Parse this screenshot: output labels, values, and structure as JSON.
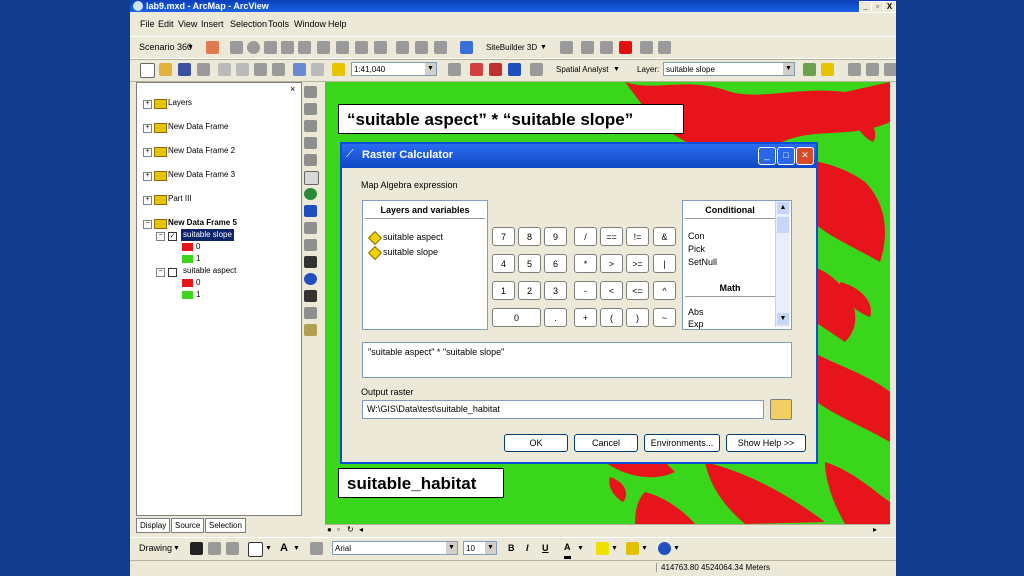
{
  "window": {
    "title": "lab9.mxd - ArcMap - ArcView",
    "controls": [
      "_",
      "▫",
      "X"
    ]
  },
  "menubar": {
    "items": [
      "File",
      "Edit",
      "View",
      "Insert",
      "Selection",
      "Tools",
      "Window",
      "Help"
    ]
  },
  "toolbar1": {
    "scenario": "Scenario 360",
    "sitebuilder": "SiteBuilder 3D"
  },
  "toolbar2": {
    "scale": "1:41,040",
    "spatial_analyst": "Spatial Analyst",
    "layer_label": "Layer:",
    "layer_value": "suitable slope"
  },
  "toc": {
    "frames": [
      "Layers",
      "New Data Frame",
      "New Data Frame 2",
      "New Data Frame 3",
      "Part III"
    ],
    "active_frame": "New Data Frame 5",
    "layers": [
      {
        "name": "suitable slope",
        "checked": true,
        "classes": [
          "0",
          "1"
        ]
      },
      {
        "name": "suitable aspect",
        "checked": false,
        "classes": [
          "0",
          "1"
        ]
      }
    ],
    "tabs": [
      "Display",
      "Source",
      "Selection"
    ]
  },
  "captions": {
    "top": "“suitable aspect” * “suitable slope”",
    "bottom": "suitable_habitat"
  },
  "dialog": {
    "title": "Raster Calculator",
    "expr_section": "Map Algebra expression",
    "layers_header": "Layers and variables",
    "layers": [
      "suitable aspect",
      "suitable slope"
    ],
    "keypad": [
      [
        "7",
        "8",
        "9",
        "/",
        "==",
        "!=",
        "&"
      ],
      [
        "4",
        "5",
        "6",
        "*",
        ">",
        ">=",
        "|"
      ],
      [
        "1",
        "2",
        "3",
        "-",
        "<",
        "<=",
        "^"
      ],
      [
        "0",
        ".",
        "+",
        "(",
        ")",
        "~"
      ]
    ],
    "conditional_header": "Conditional",
    "conditional_items": [
      "Con",
      "Pick",
      "SetNull"
    ],
    "math_header": "Math",
    "math_items": [
      "Abs",
      "Exp"
    ],
    "expression": "\"suitable aspect\" * \"suitable slope\"",
    "output_label": "Output raster",
    "output_path": "W:\\GIS\\Data\\test\\suitable_habitat",
    "buttons": {
      "ok": "OK",
      "cancel": "Cancel",
      "env": "Environments...",
      "help": "Show Help >>"
    }
  },
  "draw_toolbar": {
    "drawing": "Drawing",
    "font": "Arial",
    "size": "10",
    "bold": "B",
    "italic": "I",
    "underline": "U",
    "text_tool": "A"
  },
  "status": {
    "coords": "414763.80  4524064.34 Meters"
  },
  "colors": {
    "map_green": "#39d61c",
    "map_red": "#e8141c",
    "title_blue": "#0a3fb8"
  }
}
